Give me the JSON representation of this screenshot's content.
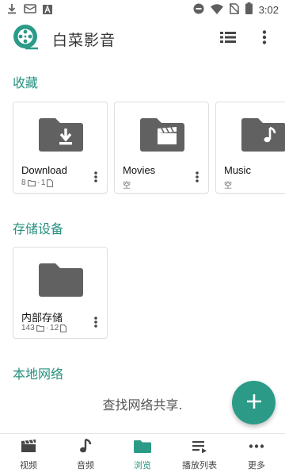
{
  "status_bar": {
    "time": "3:02"
  },
  "app": {
    "title": "白菜影音"
  },
  "sections": {
    "favorites": "收藏",
    "storage": "存储设备",
    "network": "本地网络"
  },
  "favorites": [
    {
      "name": "Download",
      "folders": "8",
      "files": "1",
      "icon": "download-icon",
      "empty": ""
    },
    {
      "name": "Movies",
      "folders": "",
      "files": "",
      "icon": "movie-icon",
      "empty": "空"
    },
    {
      "name": "Music",
      "folders": "",
      "files": "",
      "icon": "music-note-icon",
      "empty": "空"
    }
  ],
  "storage": [
    {
      "name": "内部存储",
      "folders": "143",
      "files": "12"
    }
  ],
  "network": {
    "empty_message": "查找网络共享."
  },
  "bottom_nav": [
    {
      "label": "视频",
      "icon": "video-icon",
      "active": false
    },
    {
      "label": "音频",
      "icon": "music-icon",
      "active": false
    },
    {
      "label": "浏览",
      "icon": "folder-icon",
      "active": true
    },
    {
      "label": "播放列表",
      "icon": "playlist-icon",
      "active": false
    },
    {
      "label": "更多",
      "icon": "more-horizontal-icon",
      "active": false
    }
  ],
  "colors": {
    "accent": "#26917f",
    "fab": "#2b9b87",
    "folder": "#616161"
  }
}
